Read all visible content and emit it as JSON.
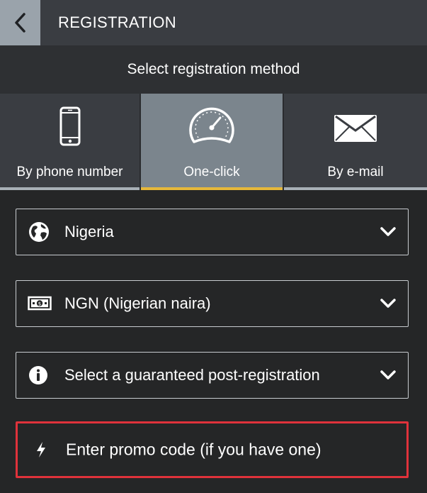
{
  "header": {
    "title": "REGISTRATION",
    "back_icon": "chevron-left-icon"
  },
  "subheader": {
    "text": "Select registration method"
  },
  "tabs": [
    {
      "label": "By phone number",
      "icon": "phone-icon",
      "active": false
    },
    {
      "label": "One-click",
      "icon": "speedometer-icon",
      "active": true
    },
    {
      "label": "By e-mail",
      "icon": "envelope-icon",
      "active": false
    }
  ],
  "fields": {
    "country": {
      "value": "Nigeria",
      "icon": "globe-icon"
    },
    "currency": {
      "value": "NGN (Nigerian naira)",
      "icon": "banknote-icon"
    },
    "bonus": {
      "value": "Select a guaranteed post-registration",
      "icon": "info-icon"
    }
  },
  "promo": {
    "text": "Enter promo code (if you have one)",
    "icon": "lightning-icon"
  },
  "colors": {
    "background": "#252627",
    "header": "#3a3d42",
    "active_tab": "#7b858d",
    "active_underline": "#e6b83a",
    "promo_border": "#e0323b"
  }
}
